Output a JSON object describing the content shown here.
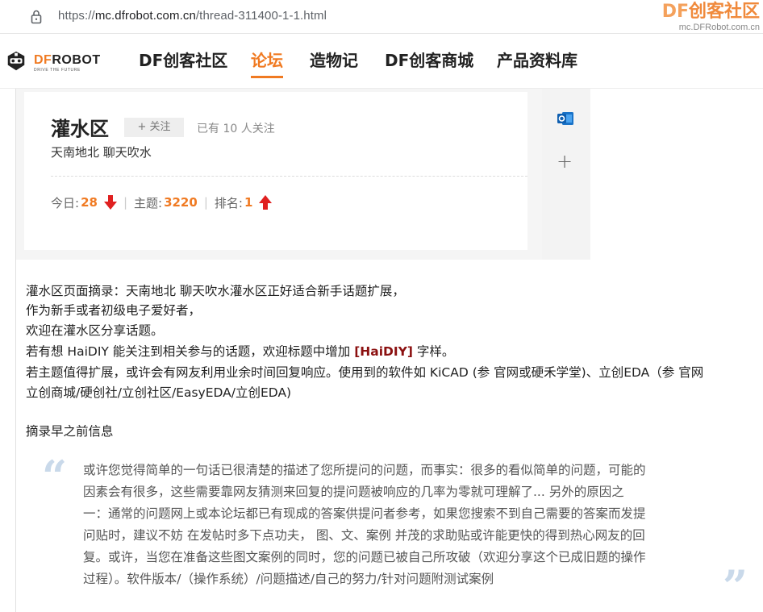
{
  "browser": {
    "url_scheme": "https://",
    "url_host": "mc.dfrobot.com.cn",
    "url_path": "/thread-311400-1-1.html",
    "watermark_df": "DF",
    "watermark_title": "创客社区",
    "watermark_sub": "mc.DFRobot.com.cn"
  },
  "nav": {
    "logo_df": "DF",
    "logo_robot": "ROBOT",
    "logo_tagline": "DRIVE THE FUTURE",
    "items": [
      {
        "label": "DF创客社区",
        "active": false
      },
      {
        "label": "论坛",
        "active": true
      },
      {
        "label": "造物记",
        "active": false
      },
      {
        "label": "DF创客商城",
        "active": false
      },
      {
        "label": "产品资料库",
        "active": false
      }
    ]
  },
  "forum": {
    "title": "灌水区",
    "follow_label": "+ 关注",
    "followers_text": "已有 10 人关注",
    "description": "天南地北 聊天吹水",
    "stats": {
      "today_label": "今日:",
      "today_value": "28",
      "topics_label": "主题:",
      "topics_value": "3220",
      "rank_label": "排名:",
      "rank_value": "1",
      "separator": "|"
    }
  },
  "content": {
    "lines": [
      "灌水区页面摘录：天南地北 聊天吹水灌水区正好适合新手话题扩展，",
      "作为新手或者初级电子爱好者，",
      "欢迎在灌水区分享话题。"
    ],
    "haidiy_prefix": "若有想 HaiDIY 能关注到相关参与的话题，欢迎标题中增加 ",
    "haidiy_tag": "[HaiDIY]",
    "haidiy_suffix": " 字样。",
    "software_line1": "若主题值得扩展，或许会有网友利用业余时间回复响应。使用到的软件如 KiCAD (参 官网或硬禾学堂)、立创EDA（参 官网",
    "software_line2": "立创商城/硬创社/立创社区/EasyEDA/立创EDA)",
    "excerpt_heading": "摘录早之前信息",
    "quote_open": "“",
    "quote_close": "”",
    "quote_lines": [
      "或许您觉得简单的一句话已很清楚的描述了您所提问的问题，而事实：很多的看似简单的问题，可能的",
      "因素会有很多，这些需要靠网友猜测来回复的提问题被响应的几率为零就可理解了...      另外的原因之",
      "一：通常的问题网上或本论坛都已有现成的答案供提问者参考，如果您搜索不到自己需要的答案而发提",
      "问贴时，建议不妨 在发帖时多下点功夫，  图、文、案例 并茂的求助贴或许能更快的得到热心网友的回",
      "复。或许，当您在准备这些图文案例的同时，您的问题已被自己所攻破（欢迎分享这个已成旧题的操作",
      "过程）。软件版本/（操作系统）/问题描述/自己的努力/针对问题附测试案例"
    ]
  },
  "colors": {
    "accent": "#f07a22",
    "highlight": "#8b1010",
    "arrow_red": "#e02020",
    "quote_mark": "#c9d9ea"
  },
  "icons": [
    "lock-icon",
    "dfrobot-logo-icon",
    "down-arrow-icon",
    "up-arrow-icon",
    "outlook-icon",
    "plus-icon"
  ]
}
